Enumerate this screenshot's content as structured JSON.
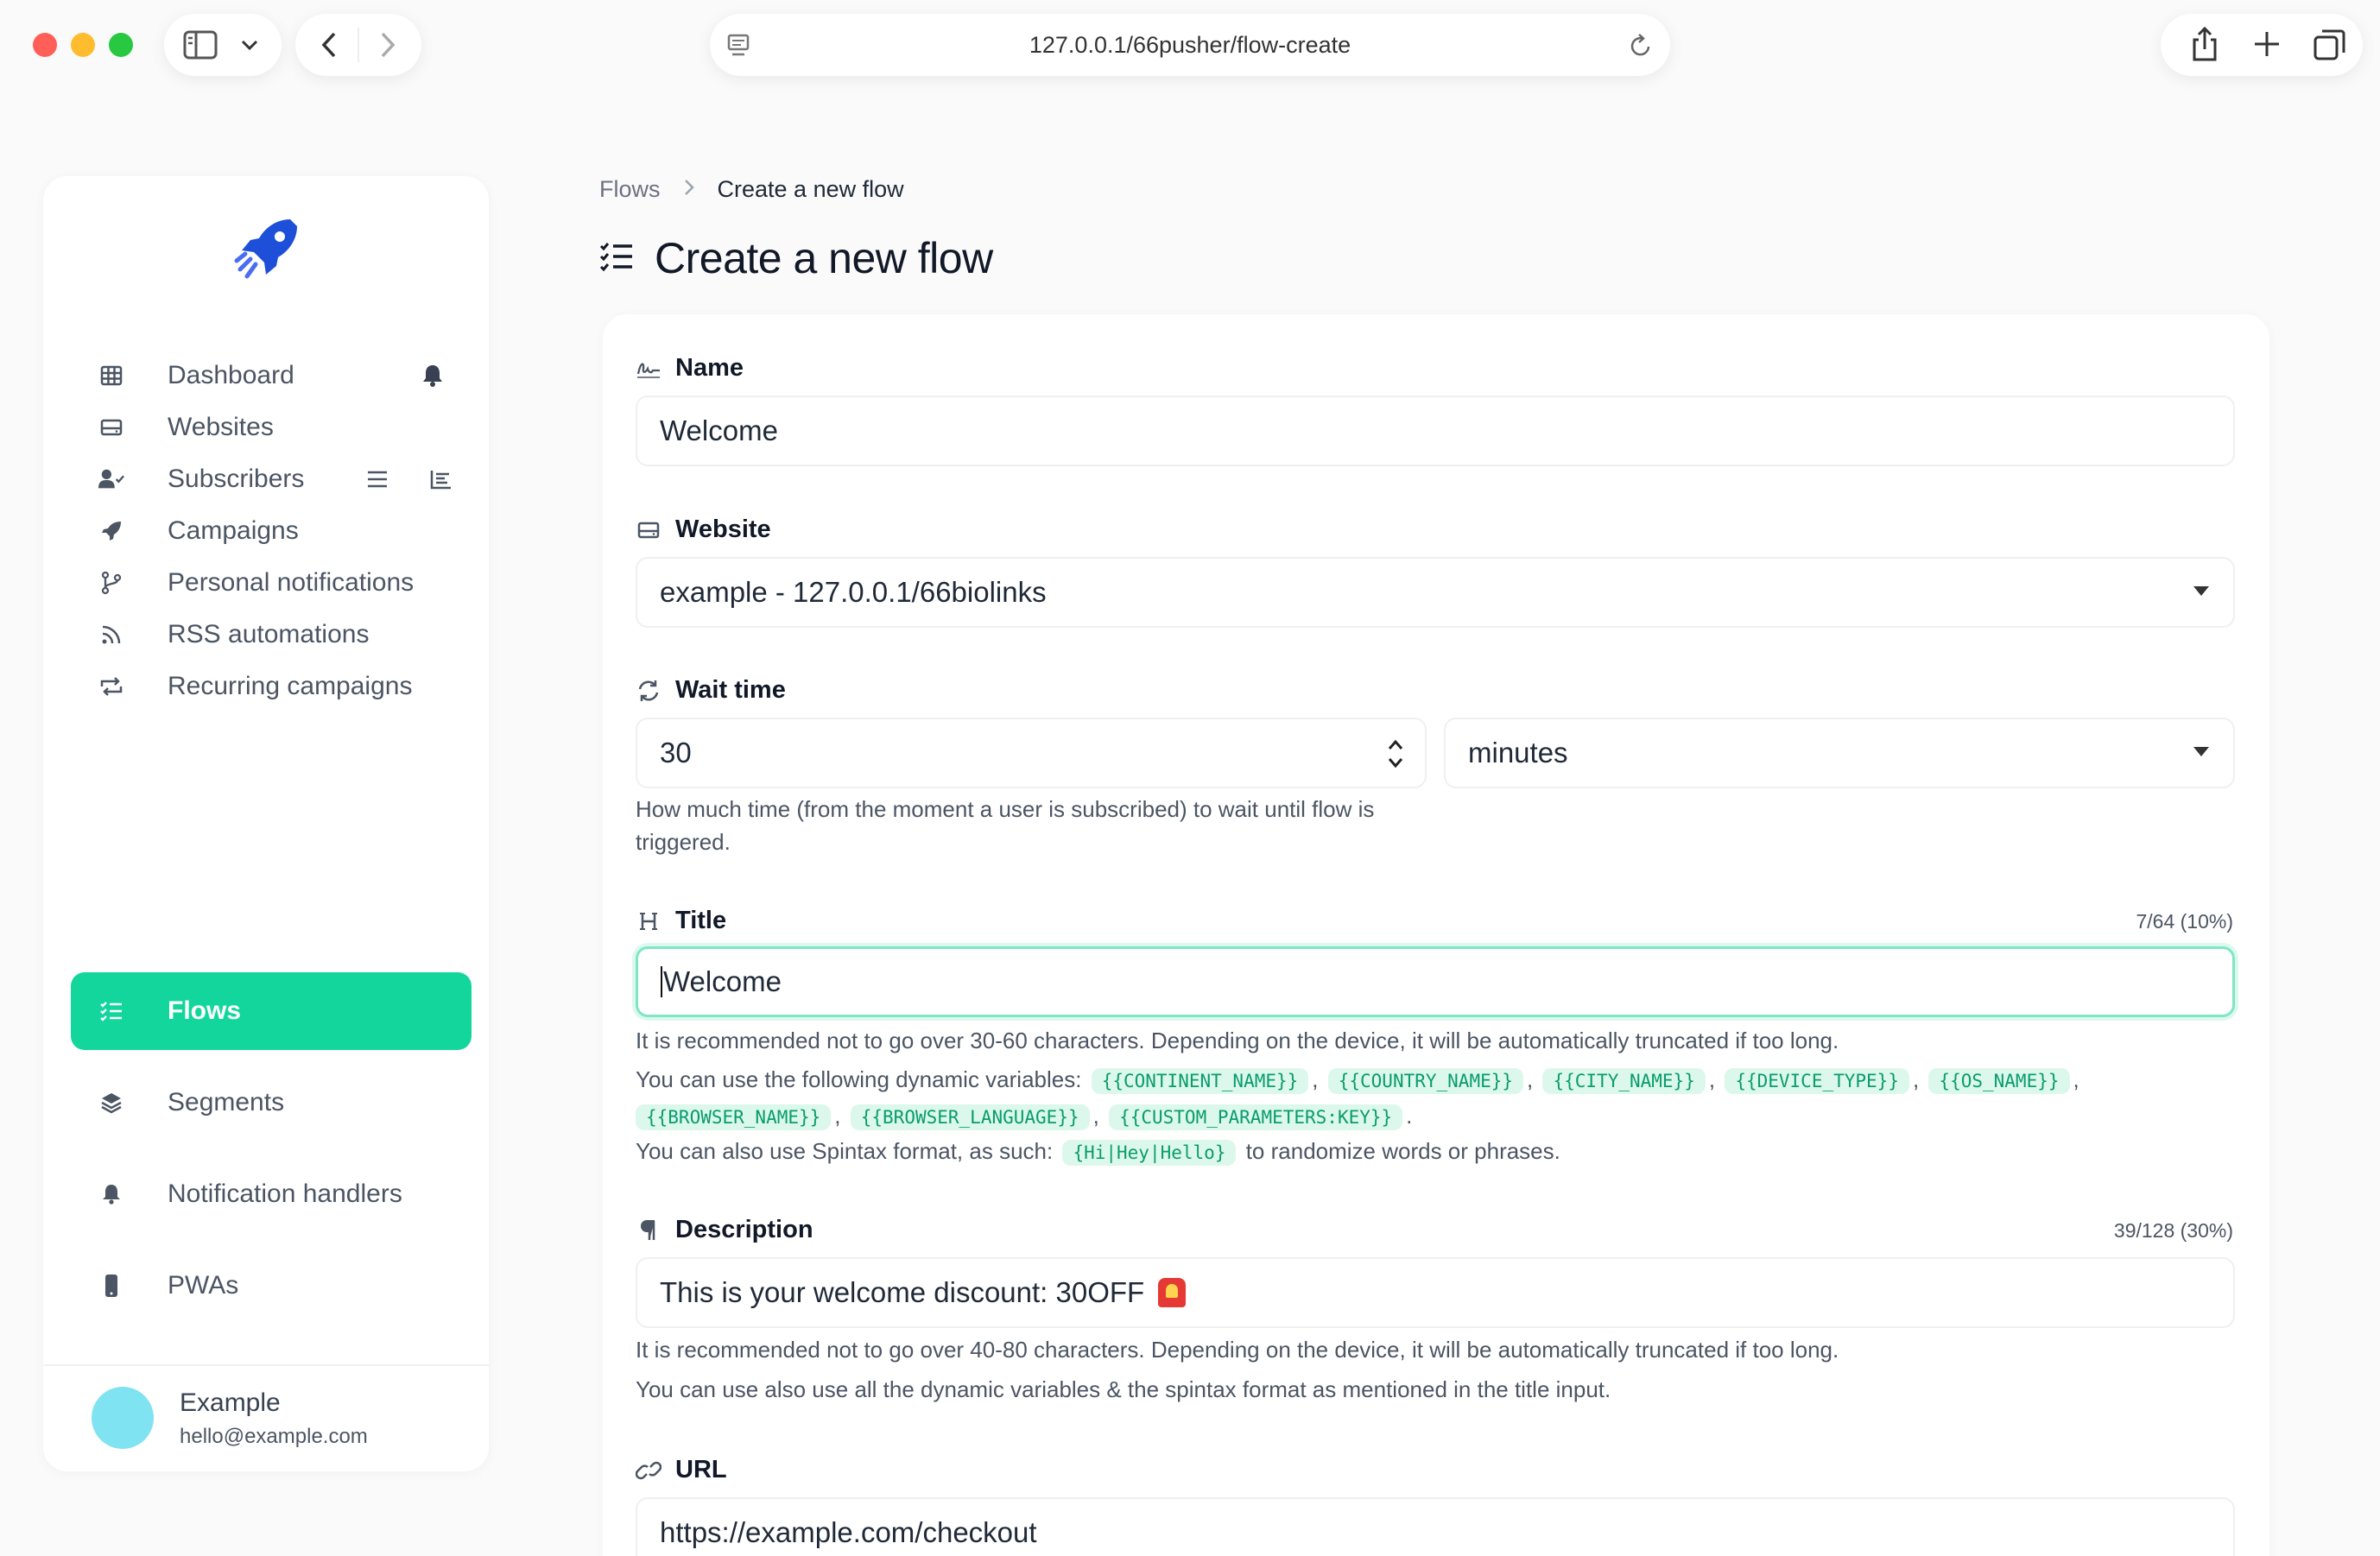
{
  "browser": {
    "url": "127.0.0.1/66pusher/flow-create"
  },
  "sidebar": {
    "items": [
      {
        "label": "Dashboard",
        "icon": "table-icon"
      },
      {
        "label": "Websites",
        "icon": "hard-drive-icon"
      },
      {
        "label": "Subscribers",
        "icon": "user-check-icon"
      },
      {
        "label": "Campaigns",
        "icon": "rocket-icon"
      },
      {
        "label": "Personal notifications",
        "icon": "branch-icon"
      },
      {
        "label": "RSS automations",
        "icon": "rss-icon"
      },
      {
        "label": "Recurring campaigns",
        "icon": "repeat-icon"
      },
      {
        "label": "Flows",
        "icon": "list-check-icon",
        "active": true
      },
      {
        "label": "Segments",
        "icon": "layers-icon"
      },
      {
        "label": "Notification handlers",
        "icon": "bell-icon"
      },
      {
        "label": "PWAs",
        "icon": "mobile-icon"
      }
    ],
    "user": {
      "name": "Example",
      "email": "hello@example.com"
    }
  },
  "breadcrumb": {
    "parent": "Flows",
    "current": "Create a new flow"
  },
  "page": {
    "title": "Create a new flow"
  },
  "form": {
    "name": {
      "label": "Name",
      "value": "Welcome"
    },
    "website": {
      "label": "Website",
      "value": "example - 127.0.0.1/66biolinks"
    },
    "wait_time": {
      "label": "Wait time",
      "value": "30",
      "unit": "minutes",
      "help_line1": "How much time (from the moment a user is subscribed) to wait until flow is",
      "help_line2": "triggered."
    },
    "title": {
      "label": "Title",
      "counter": "7/64 (10%)",
      "value": "Welcome",
      "help": "It is recommended not to go over 30-60 characters. Depending on the device, it will be automatically truncated if too long.",
      "vars_intro": "You can use the following dynamic variables:",
      "variables": [
        "{{CONTINENT_NAME}}",
        "{{COUNTRY_NAME}}",
        "{{CITY_NAME}}",
        "{{DEVICE_TYPE}}",
        "{{OS_NAME}}",
        "{{BROWSER_NAME}}",
        "{{BROWSER_LANGUAGE}}",
        "{{CUSTOM_PARAMETERS:KEY}}"
      ],
      "spintax_intro": "You can also use Spintax format, as such:",
      "spintax_example": "{Hi|Hey|Hello}",
      "spintax_outro": "to randomize words or phrases."
    },
    "description": {
      "label": "Description",
      "counter": "39/128 (30%)",
      "value": "This is your welcome discount: 30OFF",
      "help1": "It is recommended not to go over 40-80 characters. Depending on the device, it will be automatically truncated if too long.",
      "help2": "You can use also use all the dynamic variables & the spintax format as mentioned in the title input."
    },
    "url": {
      "label": "URL",
      "value": "https://example.com/checkout"
    }
  },
  "colors": {
    "accent": "#12d69c",
    "code_bg": "#dcf8ec",
    "code_text": "#0a9c6e"
  }
}
